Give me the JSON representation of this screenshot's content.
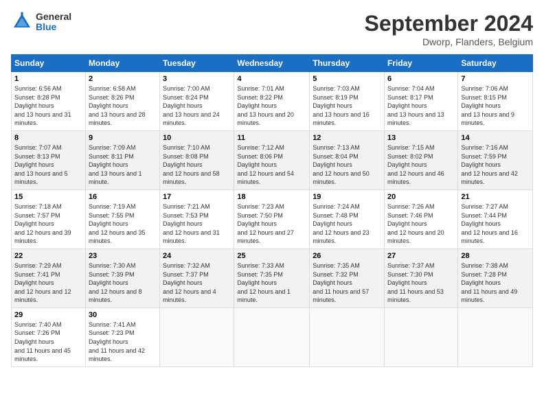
{
  "logo": {
    "general": "General",
    "blue": "Blue"
  },
  "title": "September 2024",
  "subtitle": "Dworp, Flanders, Belgium",
  "headers": [
    "Sunday",
    "Monday",
    "Tuesday",
    "Wednesday",
    "Thursday",
    "Friday",
    "Saturday"
  ],
  "weeks": [
    [
      {
        "day": "1",
        "sunrise": "6:56 AM",
        "sunset": "8:28 PM",
        "daylight": "13 hours and 31 minutes."
      },
      {
        "day": "2",
        "sunrise": "6:58 AM",
        "sunset": "8:26 PM",
        "daylight": "13 hours and 28 minutes."
      },
      {
        "day": "3",
        "sunrise": "7:00 AM",
        "sunset": "8:24 PM",
        "daylight": "13 hours and 24 minutes."
      },
      {
        "day": "4",
        "sunrise": "7:01 AM",
        "sunset": "8:22 PM",
        "daylight": "13 hours and 20 minutes."
      },
      {
        "day": "5",
        "sunrise": "7:03 AM",
        "sunset": "8:19 PM",
        "daylight": "13 hours and 16 minutes."
      },
      {
        "day": "6",
        "sunrise": "7:04 AM",
        "sunset": "8:17 PM",
        "daylight": "13 hours and 13 minutes."
      },
      {
        "day": "7",
        "sunrise": "7:06 AM",
        "sunset": "8:15 PM",
        "daylight": "13 hours and 9 minutes."
      }
    ],
    [
      {
        "day": "8",
        "sunrise": "7:07 AM",
        "sunset": "8:13 PM",
        "daylight": "13 hours and 5 minutes."
      },
      {
        "day": "9",
        "sunrise": "7:09 AM",
        "sunset": "8:11 PM",
        "daylight": "13 hours and 1 minute."
      },
      {
        "day": "10",
        "sunrise": "7:10 AM",
        "sunset": "8:08 PM",
        "daylight": "12 hours and 58 minutes."
      },
      {
        "day": "11",
        "sunrise": "7:12 AM",
        "sunset": "8:06 PM",
        "daylight": "12 hours and 54 minutes."
      },
      {
        "day": "12",
        "sunrise": "7:13 AM",
        "sunset": "8:04 PM",
        "daylight": "12 hours and 50 minutes."
      },
      {
        "day": "13",
        "sunrise": "7:15 AM",
        "sunset": "8:02 PM",
        "daylight": "12 hours and 46 minutes."
      },
      {
        "day": "14",
        "sunrise": "7:16 AM",
        "sunset": "7:59 PM",
        "daylight": "12 hours and 42 minutes."
      }
    ],
    [
      {
        "day": "15",
        "sunrise": "7:18 AM",
        "sunset": "7:57 PM",
        "daylight": "12 hours and 39 minutes."
      },
      {
        "day": "16",
        "sunrise": "7:19 AM",
        "sunset": "7:55 PM",
        "daylight": "12 hours and 35 minutes."
      },
      {
        "day": "17",
        "sunrise": "7:21 AM",
        "sunset": "7:53 PM",
        "daylight": "12 hours and 31 minutes."
      },
      {
        "day": "18",
        "sunrise": "7:23 AM",
        "sunset": "7:50 PM",
        "daylight": "12 hours and 27 minutes."
      },
      {
        "day": "19",
        "sunrise": "7:24 AM",
        "sunset": "7:48 PM",
        "daylight": "12 hours and 23 minutes."
      },
      {
        "day": "20",
        "sunrise": "7:26 AM",
        "sunset": "7:46 PM",
        "daylight": "12 hours and 20 minutes."
      },
      {
        "day": "21",
        "sunrise": "7:27 AM",
        "sunset": "7:44 PM",
        "daylight": "12 hours and 16 minutes."
      }
    ],
    [
      {
        "day": "22",
        "sunrise": "7:29 AM",
        "sunset": "7:41 PM",
        "daylight": "12 hours and 12 minutes."
      },
      {
        "day": "23",
        "sunrise": "7:30 AM",
        "sunset": "7:39 PM",
        "daylight": "12 hours and 8 minutes."
      },
      {
        "day": "24",
        "sunrise": "7:32 AM",
        "sunset": "7:37 PM",
        "daylight": "12 hours and 4 minutes."
      },
      {
        "day": "25",
        "sunrise": "7:33 AM",
        "sunset": "7:35 PM",
        "daylight": "12 hours and 1 minute."
      },
      {
        "day": "26",
        "sunrise": "7:35 AM",
        "sunset": "7:32 PM",
        "daylight": "11 hours and 57 minutes."
      },
      {
        "day": "27",
        "sunrise": "7:37 AM",
        "sunset": "7:30 PM",
        "daylight": "11 hours and 53 minutes."
      },
      {
        "day": "28",
        "sunrise": "7:38 AM",
        "sunset": "7:28 PM",
        "daylight": "11 hours and 49 minutes."
      }
    ],
    [
      {
        "day": "29",
        "sunrise": "7:40 AM",
        "sunset": "7:26 PM",
        "daylight": "11 hours and 45 minutes."
      },
      {
        "day": "30",
        "sunrise": "7:41 AM",
        "sunset": "7:23 PM",
        "daylight": "11 hours and 42 minutes."
      },
      null,
      null,
      null,
      null,
      null
    ]
  ]
}
